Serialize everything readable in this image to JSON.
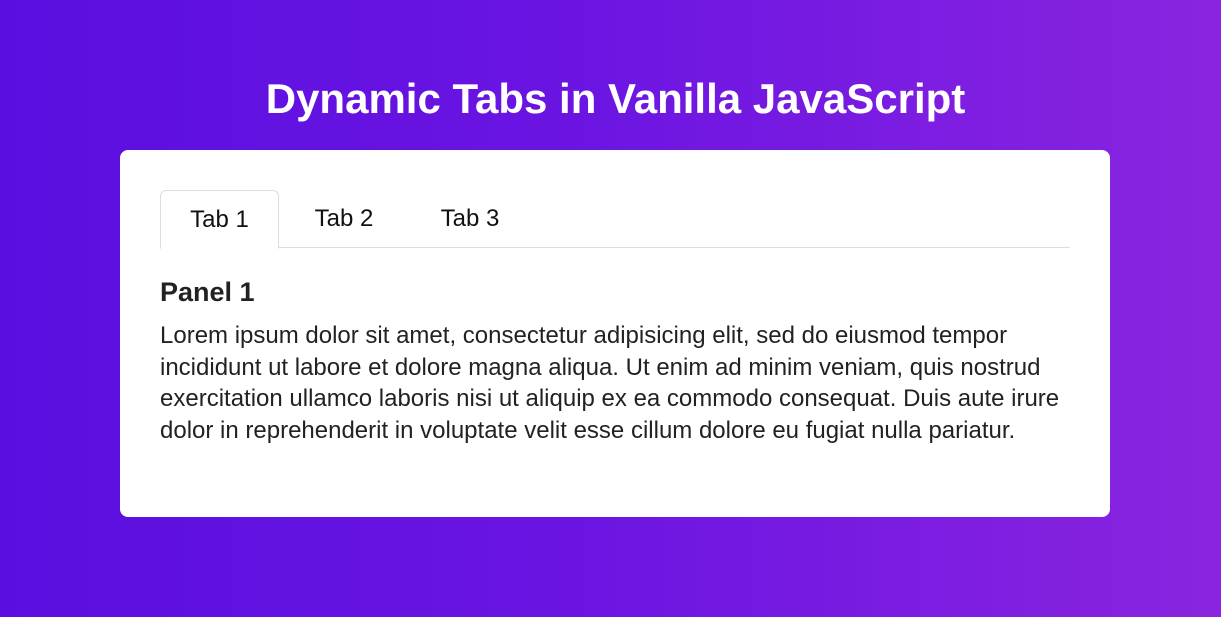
{
  "page": {
    "title": "Dynamic Tabs in Vanilla JavaScript"
  },
  "tabs": [
    {
      "label": "Tab 1",
      "active": true
    },
    {
      "label": "Tab 2",
      "active": false
    },
    {
      "label": "Tab 3",
      "active": false
    }
  ],
  "panel": {
    "title": "Panel 1",
    "body": "Lorem ipsum dolor sit amet, consectetur adipisicing elit, sed do eiusmod tempor incididunt ut labore et dolore magna aliqua. Ut enim ad minim veniam, quis nostrud exercitation ullamco laboris nisi ut aliquip ex ea commodo consequat. Duis aute irure dolor in reprehenderit in voluptate velit esse cillum dolore eu fugiat nulla pariatur."
  },
  "colors": {
    "background_start": "#5a0fe0",
    "background_end": "#8a24e0",
    "card": "#ffffff",
    "title_text": "#ffffff",
    "body_text": "#222222",
    "tab_border": "#dddddd"
  }
}
